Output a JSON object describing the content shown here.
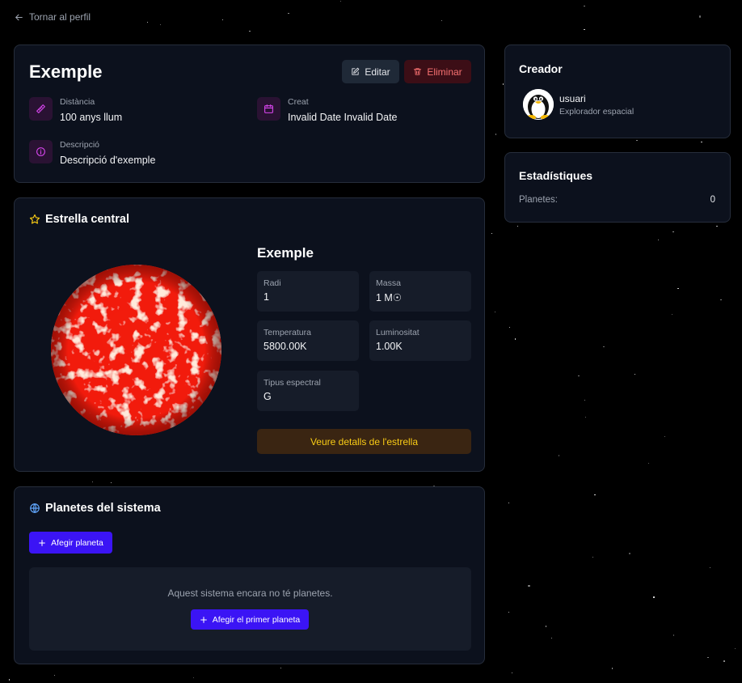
{
  "nav": {
    "back_label": "Tornar al perfil"
  },
  "system": {
    "title": "Exemple",
    "edit_label": "Editar",
    "delete_label": "Eliminar",
    "distance_label": "Distància",
    "distance_value": "100 anys llum",
    "created_label": "Creat",
    "created_value": "Invalid Date Invalid Date",
    "description_label": "Descripció",
    "description_value": "Descripció d'exemple"
  },
  "creator": {
    "title": "Creador",
    "username": "usuari",
    "role": "Explorador espacial"
  },
  "stats": {
    "title": "Estadístiques",
    "planets_label": "Planetes:",
    "planets_value": "0"
  },
  "star": {
    "section_title": "Estrella central",
    "name": "Exemple",
    "radius_label": "Radi",
    "radius_value": "1",
    "mass_label": "Massa",
    "mass_value": "1 M☉",
    "temperature_label": "Temperatura",
    "temperature_value": "5800.00K",
    "luminosity_label": "Luminositat",
    "luminosity_value": "1.00K",
    "spectral_label": "Tipus espectral",
    "spectral_value": "G",
    "details_button": "Veure detalls de l'estrella"
  },
  "planets": {
    "section_title": "Planetes del sistema",
    "add_button": "Afegir planeta",
    "empty_text": "Aquest sistema encara no té planetes.",
    "first_button": "Afegir el primer planeta"
  },
  "colors": {
    "background": "#000000",
    "card": "#0c111d",
    "accent_primary": "#3b14f5",
    "accent_danger": "#f87171",
    "accent_star": "#facc15",
    "icon_magenta": "#d946ef"
  }
}
